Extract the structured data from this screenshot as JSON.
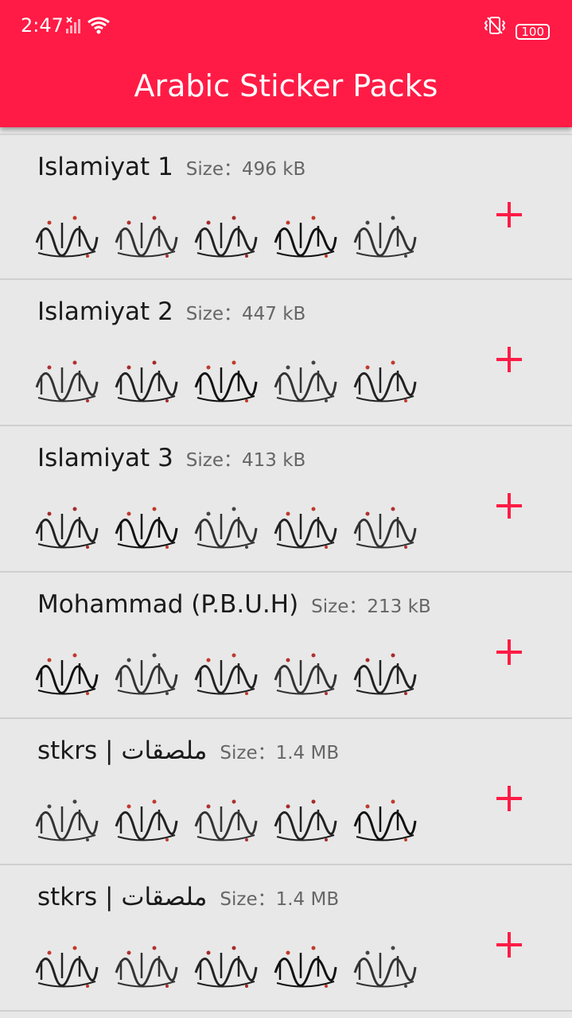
{
  "status_bar": {
    "time": "2:47",
    "battery": "100",
    "icons": [
      "no-signal-icon",
      "wifi-icon",
      "vibrate-icon",
      "battery-icon"
    ]
  },
  "app_bar": {
    "title": "Arabic Sticker Packs"
  },
  "colors": {
    "accent": "#ff1b45",
    "background": "#e8e8e8",
    "divider": "#cfcfcf"
  },
  "size_label": "Size：",
  "packs": [
    {
      "name": "Islamiyat 1",
      "size": "496 kB",
      "stickers": [
        "calligraphy-sticker",
        "calligraphy-sticker",
        "calligraphy-sticker",
        "calligraphy-sticker",
        "calligraphy-sticker"
      ]
    },
    {
      "name": "Islamiyat 2",
      "size": "447 kB",
      "stickers": [
        "calligraphy-sticker",
        "calligraphy-sticker",
        "calligraphy-sticker",
        "calligraphy-sticker",
        "calligraphy-sticker"
      ]
    },
    {
      "name": "Islamiyat 3",
      "size": "413 kB",
      "stickers": [
        "calligraphy-sticker",
        "calligraphy-sticker",
        "calligraphy-sticker",
        "calligraphy-sticker",
        "calligraphy-sticker"
      ]
    },
    {
      "name": "Mohammad (P.B.U.H)",
      "size": "213 kB",
      "stickers": [
        "calligraphy-sticker",
        "calligraphy-sticker",
        "calligraphy-sticker",
        "calligraphy-sticker",
        "calligraphy-sticker"
      ]
    },
    {
      "name": "stkrs | ملصقات",
      "size": "1.4 MB",
      "stickers": [
        "calligraphy-sticker",
        "calligraphy-sticker",
        "calligraphy-sticker",
        "calligraphy-sticker",
        "calligraphy-sticker"
      ]
    },
    {
      "name": "stkrs | ملصقات",
      "size": "1.4 MB",
      "stickers": [
        "calligraphy-sticker",
        "calligraphy-sticker",
        "calligraphy-sticker",
        "calligraphy-sticker",
        "calligraphy-sticker"
      ]
    }
  ]
}
